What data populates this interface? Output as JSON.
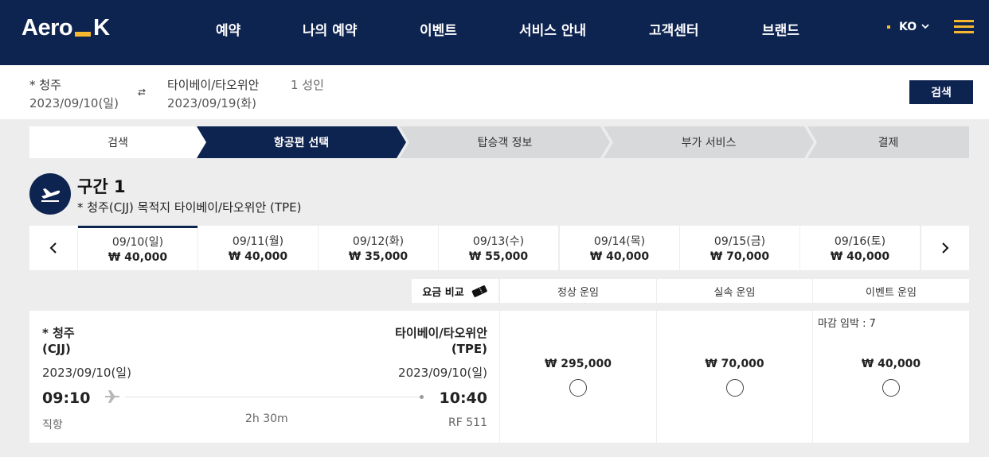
{
  "header": {
    "logo_left": "Aero",
    "logo_right": "K",
    "nav": [
      "예약",
      "나의 예약",
      "이벤트",
      "서비스 안내",
      "고객센터",
      "브랜드"
    ],
    "lang": "KO",
    "colors": {
      "primary": "#0d2350",
      "accent": "#f5b82e"
    }
  },
  "search_summary": {
    "origin": "* 청주",
    "depart_date": "2023/09/10(일)",
    "destination": "타이베이/타오위안",
    "return_date": "2023/09/19(화)",
    "passengers": "1 성인",
    "search_label": "검색"
  },
  "steps": [
    "검색",
    "항공편 선택",
    "탑승객 정보",
    "부가 서비스",
    "결제"
  ],
  "segment": {
    "title": "구간 1",
    "route": "* 청주(CJJ) 목적지 타이베이/타오위안 (TPE)"
  },
  "dates": [
    {
      "date": "09/10(일)",
      "price": "₩ 40,000"
    },
    {
      "date": "09/11(월)",
      "price": "₩ 40,000"
    },
    {
      "date": "09/12(화)",
      "price": "₩ 35,000"
    },
    {
      "date": "09/13(수)",
      "price": "₩ 55,000"
    },
    {
      "date": "09/14(목)",
      "price": "₩ 40,000"
    },
    {
      "date": "09/15(금)",
      "price": "₩ 70,000"
    },
    {
      "date": "09/16(토)",
      "price": "₩ 40,000"
    }
  ],
  "fare_header": {
    "compare": "요금 비교",
    "fares": [
      "정상 운임",
      "실속 운임",
      "이벤트 운임"
    ]
  },
  "flight": {
    "origin_city": "* 청주",
    "origin_code": "(CJJ)",
    "dest_city": "타이베이/타오위안",
    "dest_code": "(TPE)",
    "depart_date": "2023/09/10(일)",
    "arrive_date": "2023/09/10(일)",
    "depart_time": "09:10",
    "arrive_time": "10:40",
    "type": "직항",
    "duration": "2h 30m",
    "flight_no": "RF 511",
    "prices": [
      "₩ 295,000",
      "₩ 70,000",
      "₩ 40,000"
    ],
    "deadline": "마감 임박 : 7"
  }
}
